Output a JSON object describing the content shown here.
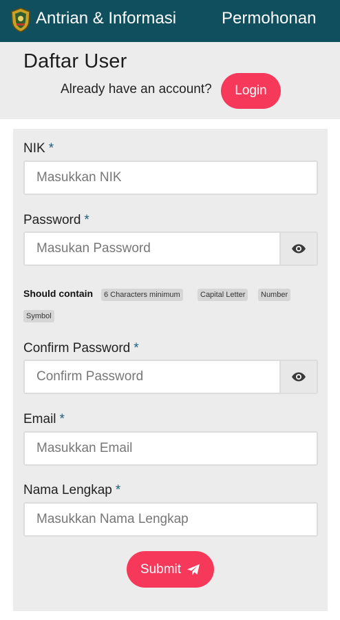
{
  "header": {
    "app_title": "Antrian & Informasi",
    "nav_link": "Permohonan",
    "logo_icon": "emblem-icon",
    "bar_color": "#10505e"
  },
  "intro": {
    "title": "Daftar User",
    "account_text": "Already have an account?",
    "login_label": "Login",
    "accent_color": "#f6385a"
  },
  "form": {
    "nik": {
      "label": "NIK",
      "required": "*",
      "placeholder": "Masukkan NIK"
    },
    "password": {
      "label": "Password",
      "required": "*",
      "placeholder": "Masukan Password",
      "toggle_icon": "eye-icon"
    },
    "password_hint": {
      "title": "Should contain",
      "rules": [
        "6 Characters minimum",
        "Capital Letter",
        "Number",
        "Symbol"
      ]
    },
    "confirm_password": {
      "label": "Confirm Password",
      "required": "*",
      "placeholder": "Confirm Password",
      "toggle_icon": "eye-icon"
    },
    "email": {
      "label": "Email",
      "required": "*",
      "placeholder": "Masukkan Email"
    },
    "full_name": {
      "label": "Nama Lengkap",
      "required": "*",
      "placeholder": "Masukkan Nama Lengkap"
    },
    "submit_label": "Submit",
    "submit_icon": "paper-plane-icon"
  }
}
